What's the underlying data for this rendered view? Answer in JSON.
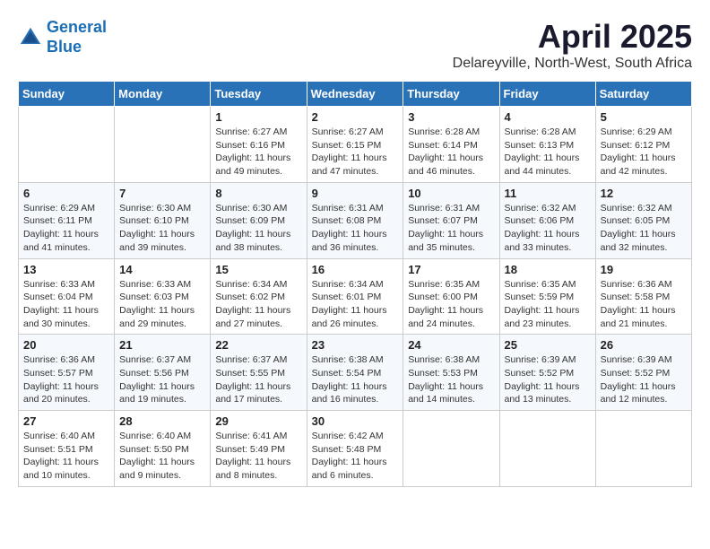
{
  "header": {
    "logo": {
      "line1": "General",
      "line2": "Blue"
    },
    "title": "April 2025",
    "subtitle": "Delareyville, North-West, South Africa"
  },
  "weekdays": [
    "Sunday",
    "Monday",
    "Tuesday",
    "Wednesday",
    "Thursday",
    "Friday",
    "Saturday"
  ],
  "weeks": [
    [
      null,
      null,
      {
        "day": "1",
        "sunrise": "Sunrise: 6:27 AM",
        "sunset": "Sunset: 6:16 PM",
        "daylight": "Daylight: 11 hours and 49 minutes."
      },
      {
        "day": "2",
        "sunrise": "Sunrise: 6:27 AM",
        "sunset": "Sunset: 6:15 PM",
        "daylight": "Daylight: 11 hours and 47 minutes."
      },
      {
        "day": "3",
        "sunrise": "Sunrise: 6:28 AM",
        "sunset": "Sunset: 6:14 PM",
        "daylight": "Daylight: 11 hours and 46 minutes."
      },
      {
        "day": "4",
        "sunrise": "Sunrise: 6:28 AM",
        "sunset": "Sunset: 6:13 PM",
        "daylight": "Daylight: 11 hours and 44 minutes."
      },
      {
        "day": "5",
        "sunrise": "Sunrise: 6:29 AM",
        "sunset": "Sunset: 6:12 PM",
        "daylight": "Daylight: 11 hours and 42 minutes."
      }
    ],
    [
      {
        "day": "6",
        "sunrise": "Sunrise: 6:29 AM",
        "sunset": "Sunset: 6:11 PM",
        "daylight": "Daylight: 11 hours and 41 minutes."
      },
      {
        "day": "7",
        "sunrise": "Sunrise: 6:30 AM",
        "sunset": "Sunset: 6:10 PM",
        "daylight": "Daylight: 11 hours and 39 minutes."
      },
      {
        "day": "8",
        "sunrise": "Sunrise: 6:30 AM",
        "sunset": "Sunset: 6:09 PM",
        "daylight": "Daylight: 11 hours and 38 minutes."
      },
      {
        "day": "9",
        "sunrise": "Sunrise: 6:31 AM",
        "sunset": "Sunset: 6:08 PM",
        "daylight": "Daylight: 11 hours and 36 minutes."
      },
      {
        "day": "10",
        "sunrise": "Sunrise: 6:31 AM",
        "sunset": "Sunset: 6:07 PM",
        "daylight": "Daylight: 11 hours and 35 minutes."
      },
      {
        "day": "11",
        "sunrise": "Sunrise: 6:32 AM",
        "sunset": "Sunset: 6:06 PM",
        "daylight": "Daylight: 11 hours and 33 minutes."
      },
      {
        "day": "12",
        "sunrise": "Sunrise: 6:32 AM",
        "sunset": "Sunset: 6:05 PM",
        "daylight": "Daylight: 11 hours and 32 minutes."
      }
    ],
    [
      {
        "day": "13",
        "sunrise": "Sunrise: 6:33 AM",
        "sunset": "Sunset: 6:04 PM",
        "daylight": "Daylight: 11 hours and 30 minutes."
      },
      {
        "day": "14",
        "sunrise": "Sunrise: 6:33 AM",
        "sunset": "Sunset: 6:03 PM",
        "daylight": "Daylight: 11 hours and 29 minutes."
      },
      {
        "day": "15",
        "sunrise": "Sunrise: 6:34 AM",
        "sunset": "Sunset: 6:02 PM",
        "daylight": "Daylight: 11 hours and 27 minutes."
      },
      {
        "day": "16",
        "sunrise": "Sunrise: 6:34 AM",
        "sunset": "Sunset: 6:01 PM",
        "daylight": "Daylight: 11 hours and 26 minutes."
      },
      {
        "day": "17",
        "sunrise": "Sunrise: 6:35 AM",
        "sunset": "Sunset: 6:00 PM",
        "daylight": "Daylight: 11 hours and 24 minutes."
      },
      {
        "day": "18",
        "sunrise": "Sunrise: 6:35 AM",
        "sunset": "Sunset: 5:59 PM",
        "daylight": "Daylight: 11 hours and 23 minutes."
      },
      {
        "day": "19",
        "sunrise": "Sunrise: 6:36 AM",
        "sunset": "Sunset: 5:58 PM",
        "daylight": "Daylight: 11 hours and 21 minutes."
      }
    ],
    [
      {
        "day": "20",
        "sunrise": "Sunrise: 6:36 AM",
        "sunset": "Sunset: 5:57 PM",
        "daylight": "Daylight: 11 hours and 20 minutes."
      },
      {
        "day": "21",
        "sunrise": "Sunrise: 6:37 AM",
        "sunset": "Sunset: 5:56 PM",
        "daylight": "Daylight: 11 hours and 19 minutes."
      },
      {
        "day": "22",
        "sunrise": "Sunrise: 6:37 AM",
        "sunset": "Sunset: 5:55 PM",
        "daylight": "Daylight: 11 hours and 17 minutes."
      },
      {
        "day": "23",
        "sunrise": "Sunrise: 6:38 AM",
        "sunset": "Sunset: 5:54 PM",
        "daylight": "Daylight: 11 hours and 16 minutes."
      },
      {
        "day": "24",
        "sunrise": "Sunrise: 6:38 AM",
        "sunset": "Sunset: 5:53 PM",
        "daylight": "Daylight: 11 hours and 14 minutes."
      },
      {
        "day": "25",
        "sunrise": "Sunrise: 6:39 AM",
        "sunset": "Sunset: 5:52 PM",
        "daylight": "Daylight: 11 hours and 13 minutes."
      },
      {
        "day": "26",
        "sunrise": "Sunrise: 6:39 AM",
        "sunset": "Sunset: 5:52 PM",
        "daylight": "Daylight: 11 hours and 12 minutes."
      }
    ],
    [
      {
        "day": "27",
        "sunrise": "Sunrise: 6:40 AM",
        "sunset": "Sunset: 5:51 PM",
        "daylight": "Daylight: 11 hours and 10 minutes."
      },
      {
        "day": "28",
        "sunrise": "Sunrise: 6:40 AM",
        "sunset": "Sunset: 5:50 PM",
        "daylight": "Daylight: 11 hours and 9 minutes."
      },
      {
        "day": "29",
        "sunrise": "Sunrise: 6:41 AM",
        "sunset": "Sunset: 5:49 PM",
        "daylight": "Daylight: 11 hours and 8 minutes."
      },
      {
        "day": "30",
        "sunrise": "Sunrise: 6:42 AM",
        "sunset": "Sunset: 5:48 PM",
        "daylight": "Daylight: 11 hours and 6 minutes."
      },
      null,
      null,
      null
    ]
  ]
}
